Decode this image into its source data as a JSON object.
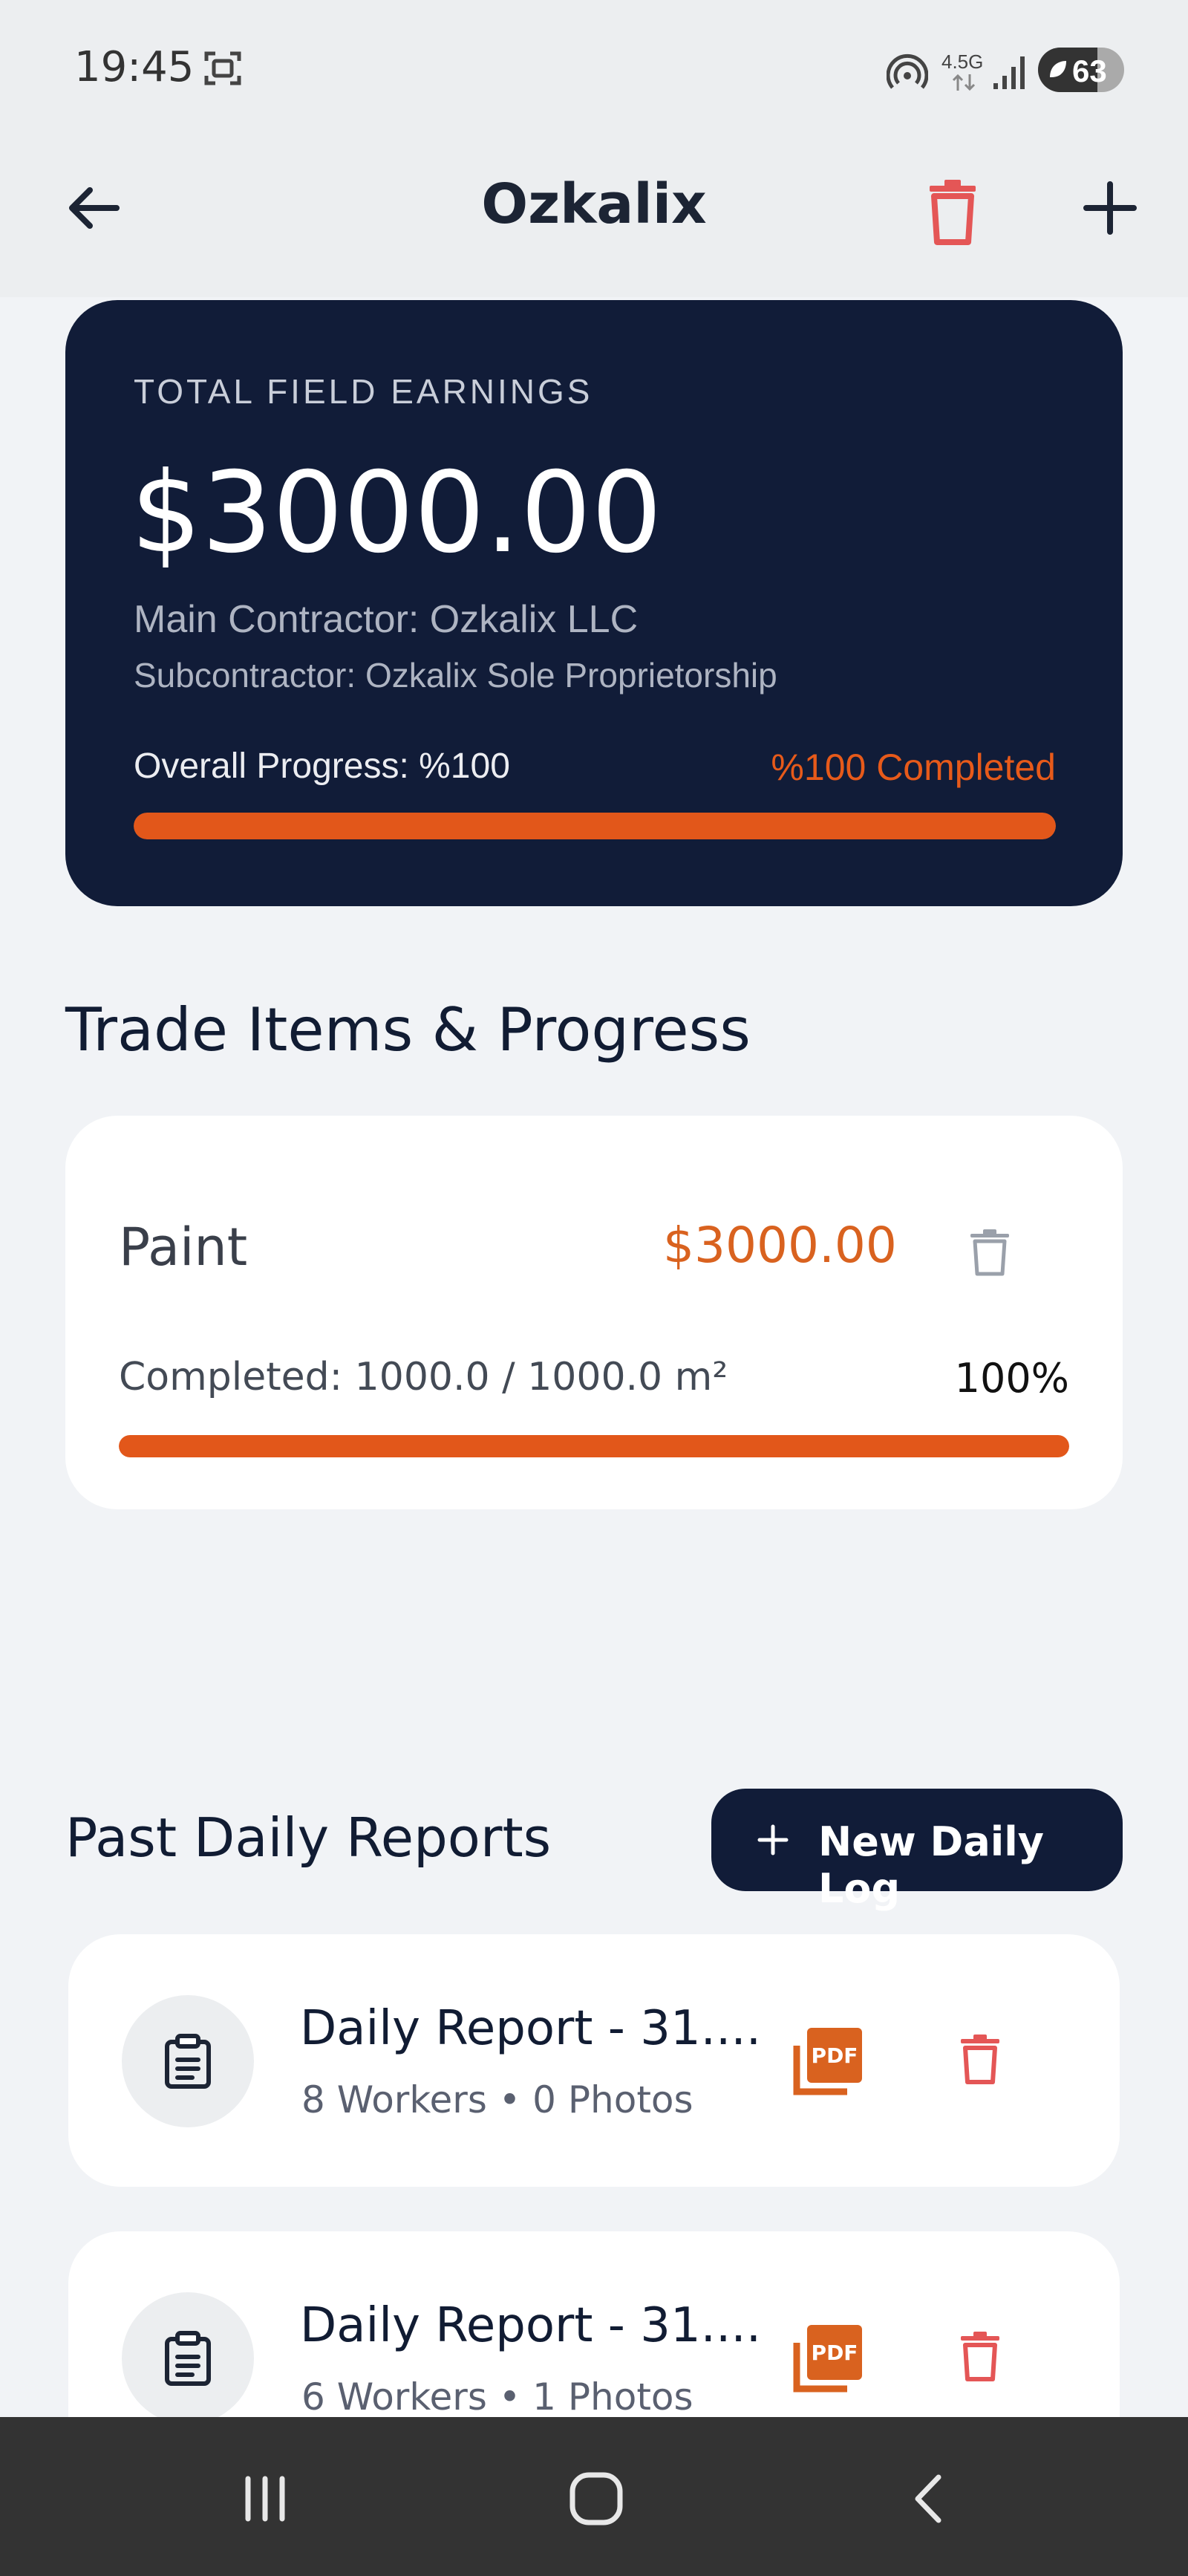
{
  "status_bar": {
    "time": "19:45",
    "network": "4.5G",
    "battery": "63",
    "icons": [
      "screenshot-icon",
      "hotspot-icon",
      "data-arrows-icon",
      "signal-icon",
      "battery-icon"
    ]
  },
  "app_bar": {
    "title": "Ozkalix",
    "back_icon": "arrow-left-icon",
    "delete_icon": "trash-icon",
    "add_icon": "plus-icon"
  },
  "summary": {
    "label": "TOTAL FIELD EARNINGS",
    "amount": "$3000.00",
    "main_contractor": "Main Contractor: Ozkalix LLC",
    "subcontractor": "Subcontractor: Ozkalix Sole Proprietorship",
    "progress_label": "Overall Progress: %100",
    "completed_label": "%100 Completed",
    "progress_fraction": 1.0
  },
  "trade_section": {
    "title": "Trade Items & Progress",
    "items": [
      {
        "name": "Paint",
        "price": "$3000.00",
        "completed": "Completed: 1000.0 / 1000.0 m²",
        "percent": "100%",
        "progress_fraction": 1.0
      }
    ]
  },
  "reports_section": {
    "title": "Past Daily Reports",
    "new_log_label": "New Daily Log",
    "reports": [
      {
        "title": "Daily Report - 31....",
        "meta": "8 Workers • 0 Photos",
        "pdf_label": "PDF"
      },
      {
        "title": "Daily Report - 31....",
        "meta": "6 Workers • 1 Photos",
        "pdf_label": "PDF"
      }
    ]
  },
  "nav_bar": {
    "items": [
      "recents-icon",
      "home-icon",
      "back-icon"
    ]
  },
  "colors": {
    "navy": "#111c38",
    "accent": "#e2571a",
    "danger": "#e45656",
    "background": "#f1f3f6"
  }
}
